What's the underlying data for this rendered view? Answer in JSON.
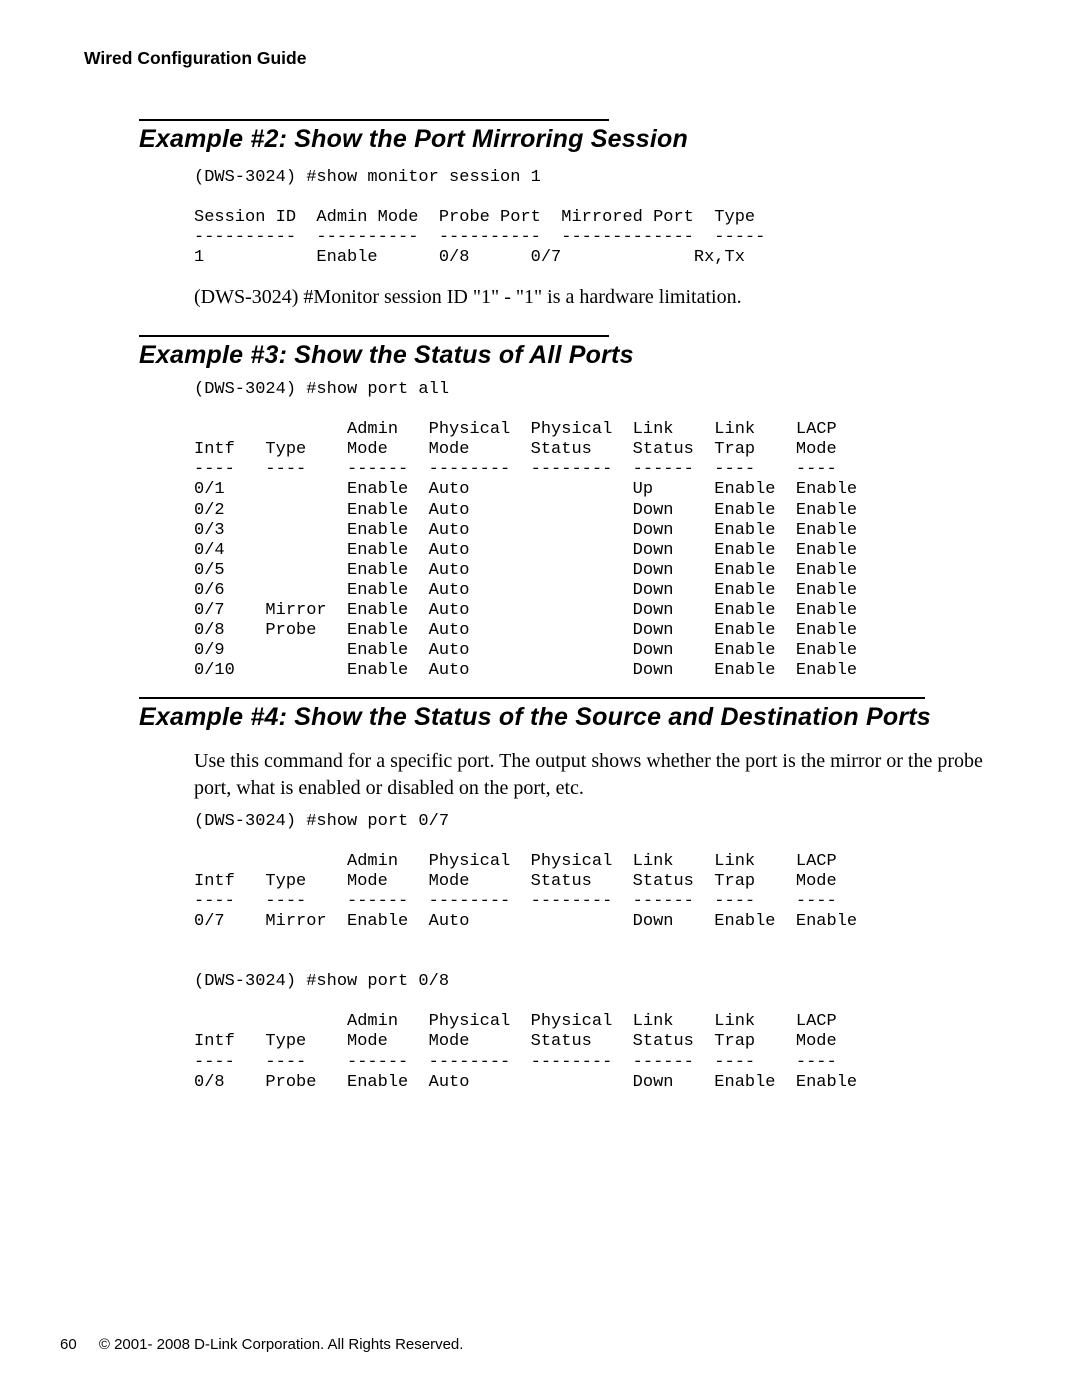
{
  "header": {
    "running": "Wired Configuration Guide"
  },
  "ex2": {
    "title": "Example #2: Show the Port Mirroring Session",
    "cmdline": "(DWS-3024) #show monitor session 1",
    "cols": [
      "Session ID",
      "Admin Mode",
      "Probe Port",
      "Mirrored Port",
      "Type"
    ],
    "rules": [
      "----------",
      "----------",
      "----------",
      "-------------",
      "-----"
    ],
    "rows": [
      {
        "session_id": "1",
        "admin_mode": "Enable",
        "probe_port": "0/8",
        "mirrored_port": "0/7",
        "type": "Rx,Tx"
      }
    ],
    "note": "(DWS-3024) #Monitor session ID \"1\" - \"1\" is a hardware limitation."
  },
  "ex3": {
    "title": "Example #3: Show the Status of All Ports",
    "cmdline": "(DWS-3024) #show port all",
    "cols_top": [
      "",
      "",
      "Admin",
      "Physical",
      "Physical",
      "Link",
      "Link",
      "LACP"
    ],
    "cols_bottom": [
      "Intf",
      "Type",
      "Mode",
      "Mode",
      "Status",
      "Status",
      "Trap",
      "Mode"
    ],
    "rules": [
      "----",
      "----",
      "------",
      "--------",
      "--------",
      "------",
      "----",
      "----"
    ],
    "rows": [
      {
        "intf": "0/1",
        "type": "",
        "admin": "Enable",
        "pmode": "Auto",
        "pstatus": "",
        "lstatus": "Up",
        "ltrap": "Enable",
        "lacp": "Enable"
      },
      {
        "intf": "0/2",
        "type": "",
        "admin": "Enable",
        "pmode": "Auto",
        "pstatus": "",
        "lstatus": "Down",
        "ltrap": "Enable",
        "lacp": "Enable"
      },
      {
        "intf": "0/3",
        "type": "",
        "admin": "Enable",
        "pmode": "Auto",
        "pstatus": "",
        "lstatus": "Down",
        "ltrap": "Enable",
        "lacp": "Enable"
      },
      {
        "intf": "0/4",
        "type": "",
        "admin": "Enable",
        "pmode": "Auto",
        "pstatus": "",
        "lstatus": "Down",
        "ltrap": "Enable",
        "lacp": "Enable"
      },
      {
        "intf": "0/5",
        "type": "",
        "admin": "Enable",
        "pmode": "Auto",
        "pstatus": "",
        "lstatus": "Down",
        "ltrap": "Enable",
        "lacp": "Enable"
      },
      {
        "intf": "0/6",
        "type": "",
        "admin": "Enable",
        "pmode": "Auto",
        "pstatus": "",
        "lstatus": "Down",
        "ltrap": "Enable",
        "lacp": "Enable"
      },
      {
        "intf": "0/7",
        "type": "Mirror",
        "admin": "Enable",
        "pmode": "Auto",
        "pstatus": "",
        "lstatus": "Down",
        "ltrap": "Enable",
        "lacp": "Enable"
      },
      {
        "intf": "0/8",
        "type": "Probe",
        "admin": "Enable",
        "pmode": "Auto",
        "pstatus": "",
        "lstatus": "Down",
        "ltrap": "Enable",
        "lacp": "Enable"
      },
      {
        "intf": "0/9",
        "type": "",
        "admin": "Enable",
        "pmode": "Auto",
        "pstatus": "",
        "lstatus": "Down",
        "ltrap": "Enable",
        "lacp": "Enable"
      },
      {
        "intf": "0/10",
        "type": "",
        "admin": "Enable",
        "pmode": "Auto",
        "pstatus": "",
        "lstatus": "Down",
        "ltrap": "Enable",
        "lacp": "Enable"
      }
    ]
  },
  "ex4": {
    "title": "Example #4: Show the Status of the Source and Destination Ports",
    "intro": "Use this command for a specific port. The output shows whether the port is the mirror or the probe port, what is enabled or disabled on the port, etc.",
    "blocks": [
      {
        "cmdline": "(DWS-3024) #show port 0/7",
        "cols_top": [
          "",
          "",
          "Admin",
          "Physical",
          "Physical",
          "Link",
          "Link",
          "LACP"
        ],
        "cols_bottom": [
          "Intf",
          "Type",
          "Mode",
          "Mode",
          "Status",
          "Status",
          "Trap",
          "Mode"
        ],
        "rules": [
          "----",
          "----",
          "------",
          "--------",
          "--------",
          "------",
          "----",
          "----"
        ],
        "rows": [
          {
            "intf": "0/7",
            "type": "Mirror",
            "admin": "Enable",
            "pmode": "Auto",
            "pstatus": "",
            "lstatus": "Down",
            "ltrap": "Enable",
            "lacp": "Enable"
          }
        ]
      },
      {
        "cmdline": "(DWS-3024) #show port 0/8",
        "cols_top": [
          "",
          "",
          "Admin",
          "Physical",
          "Physical",
          "Link",
          "Link",
          "LACP"
        ],
        "cols_bottom": [
          "Intf",
          "Type",
          "Mode",
          "Mode",
          "Status",
          "Status",
          "Trap",
          "Mode"
        ],
        "rules": [
          "----",
          "----",
          "------",
          "--------",
          "--------",
          "------",
          "----",
          "----"
        ],
        "rows": [
          {
            "intf": "0/8",
            "type": "Probe",
            "admin": "Enable",
            "pmode": "Auto",
            "pstatus": "",
            "lstatus": "Down",
            "ltrap": "Enable",
            "lacp": "Enable"
          }
        ]
      }
    ]
  },
  "footer": {
    "page": "60",
    "copyright": "© 2001- 2008 D-Link Corporation. All Rights Reserved."
  }
}
